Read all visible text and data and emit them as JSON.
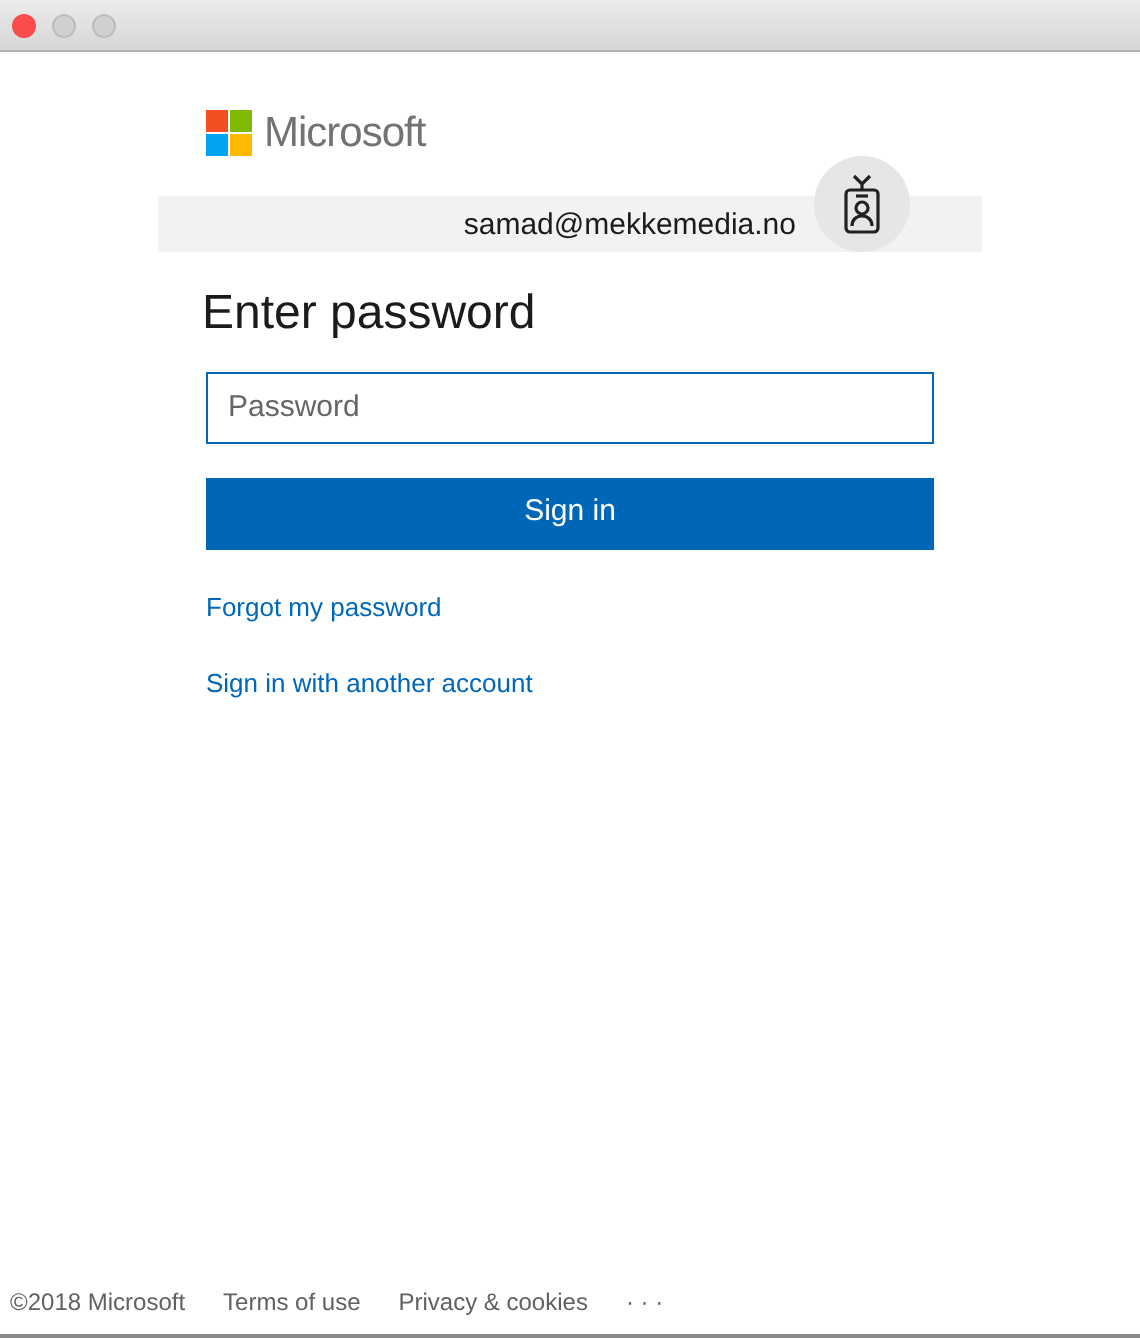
{
  "brand": {
    "name": "Microsoft"
  },
  "account": {
    "email": "samad@mekkemedia.no"
  },
  "heading": "Enter password",
  "password_field": {
    "placeholder": "Password"
  },
  "primary_button": "Sign in",
  "links": [
    "Forgot my password",
    "Sign in with another account"
  ],
  "footer": {
    "copyright": "©2018 Microsoft",
    "links": [
      "Terms of use",
      "Privacy & cookies"
    ],
    "more": "· · ·"
  }
}
